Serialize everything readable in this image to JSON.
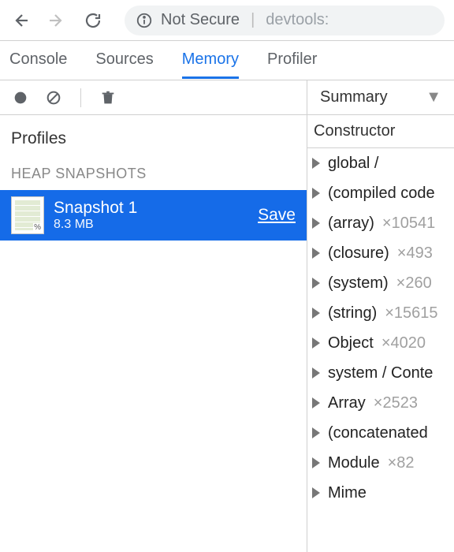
{
  "browser": {
    "not_secure": "Not Secure",
    "url_tail": "devtools:"
  },
  "tabs": {
    "console": "Console",
    "sources": "Sources",
    "memory": "Memory",
    "profiler": "Profiler"
  },
  "memory": {
    "profiles_label": "Profiles",
    "section_heap": "HEAP SNAPSHOTS",
    "snapshot": {
      "title": "Snapshot 1",
      "size": "8.3 MB",
      "save": "Save"
    }
  },
  "summary": {
    "label": "Summary",
    "header": "Constructor"
  },
  "constructors": [
    {
      "name": "global /",
      "count": ""
    },
    {
      "name": "(compiled code",
      "count": ""
    },
    {
      "name": "(array)",
      "count": "×10541"
    },
    {
      "name": "(closure)",
      "count": "×493"
    },
    {
      "name": "(system)",
      "count": "×260"
    },
    {
      "name": "(string)",
      "count": "×15615"
    },
    {
      "name": "Object",
      "count": "×4020"
    },
    {
      "name": "system / Conte",
      "count": ""
    },
    {
      "name": "Array",
      "count": "×2523"
    },
    {
      "name": "(concatenated",
      "count": ""
    },
    {
      "name": "Module",
      "count": "×82"
    },
    {
      "name": "Mime",
      "count": ""
    }
  ]
}
